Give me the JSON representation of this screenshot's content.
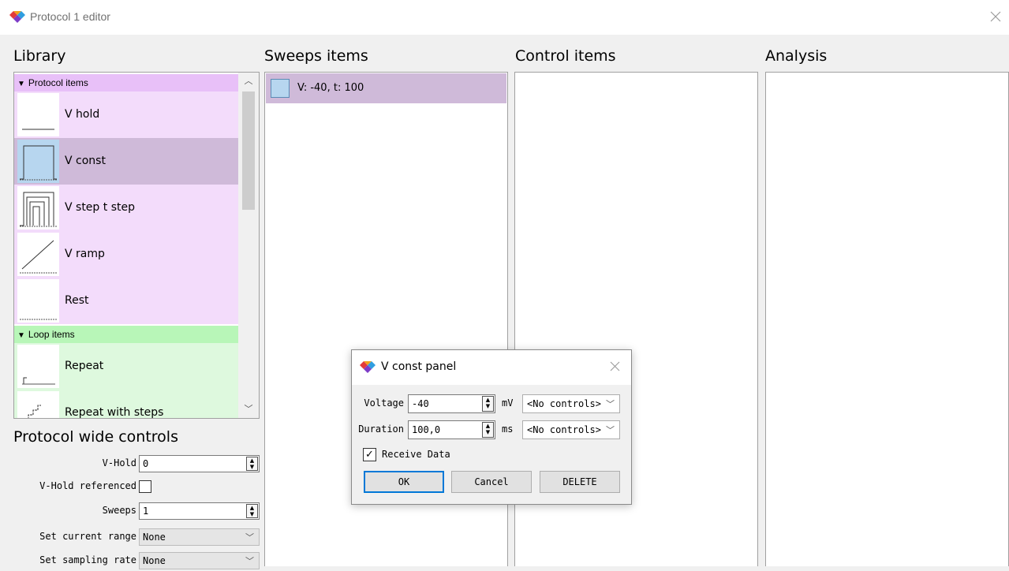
{
  "window": {
    "title": "Protocol 1 editor",
    "colors": {
      "titlebar": "#ffffff",
      "background": "#f0f0f0"
    }
  },
  "headings": {
    "library": "Library",
    "sweeps": "Sweeps items",
    "control": "Control items",
    "analysis": "Analysis"
  },
  "library": {
    "protocol_group": "Protocol items",
    "protocol_items": [
      {
        "label": "V hold",
        "icon": "v-hold-icon"
      },
      {
        "label": "V const",
        "icon": "v-const-icon",
        "selected": true
      },
      {
        "label": "V step t step",
        "icon": "v-step-icon"
      },
      {
        "label": "V ramp",
        "icon": "v-ramp-icon"
      },
      {
        "label": "Rest",
        "icon": "rest-icon"
      }
    ],
    "loop_group": "Loop items",
    "loop_items": [
      {
        "label": "Repeat",
        "icon": "repeat-icon"
      },
      {
        "label": "Repeat with steps",
        "icon": "repeat-steps-icon"
      }
    ],
    "colors": {
      "protocol_bg": "#f3dcfb",
      "protocol_header": "#e8c0f8",
      "selected": "#cfbad9",
      "loop_bg": "#def9de",
      "loop_header": "#b8f6b8"
    }
  },
  "sweeps": {
    "items": [
      {
        "label": "V: -40, t: 100",
        "icon": "v-const-icon"
      }
    ]
  },
  "protocol_wide": {
    "title": "Protocol wide controls",
    "vhold_label": "V-Hold",
    "vhold_value": "0",
    "vhold_ref_label": "V-Hold referenced",
    "vhold_ref_checked": false,
    "sweeps_label": "Sweeps",
    "sweeps_value": "1",
    "current_range_label": "Set current range",
    "current_range_value": "None",
    "sampling_rate_label": "Set sampling rate",
    "sampling_rate_value": "None"
  },
  "dialog": {
    "title": "V const panel",
    "voltage_label": "Voltage",
    "voltage_value": "-40",
    "voltage_unit": "mV",
    "voltage_control": "<No controls>",
    "duration_label": "Duration",
    "duration_value": "100,0",
    "duration_unit": "ms",
    "duration_control": "<No controls>",
    "receive_label": "Receive Data",
    "receive_checked": true,
    "ok_label": "OK",
    "cancel_label": "Cancel",
    "delete_label": "DELETE",
    "accent": "#0078d7"
  }
}
